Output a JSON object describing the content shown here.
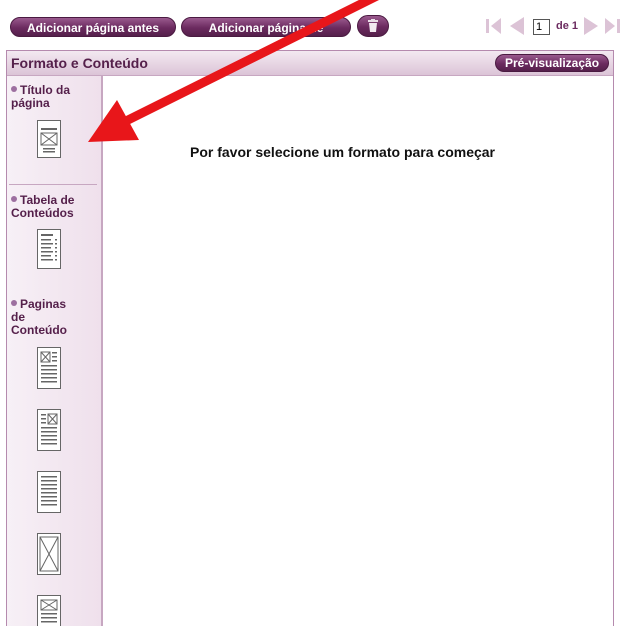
{
  "toolbar": {
    "add_before_label": "Adicionar página antes",
    "add_after_label": "Adicionar página de",
    "page_current": "1",
    "page_of_label": "de 1"
  },
  "panel": {
    "title": "Formato e Conteúdo",
    "preview_label": "Pré-visualização",
    "empty_message": "Por favor selecione um formato para começar"
  },
  "sidebar": {
    "title_page_label_line1": "Título da",
    "title_page_label_line2": "página",
    "toc_label_line1": "Tabela de",
    "toc_label_line2": "Conteúdos",
    "content_pages_label_line1": "Paginas",
    "content_pages_label_line2": "de",
    "content_pages_label_line3": "Conteúdo"
  },
  "colors": {
    "brand": "#6b2a5f",
    "annotation_arrow": "#e8161a"
  },
  "icons": {
    "delete": "trash-icon",
    "first": "first-page-icon",
    "prev": "prev-page-icon",
    "next": "next-page-icon",
    "last": "last-page-icon"
  }
}
